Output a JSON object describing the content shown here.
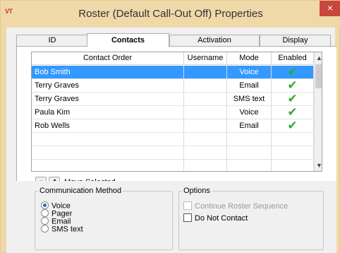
{
  "window": {
    "app_icon_text": "VT",
    "title": "Roster (Default Call-Out Off) Properties",
    "close_glyph": "×"
  },
  "tabs": [
    {
      "label": "ID",
      "active": false
    },
    {
      "label": "Contacts",
      "active": true
    },
    {
      "label": "Activation",
      "active": false
    },
    {
      "label": "Display",
      "active": false
    }
  ],
  "grid": {
    "columns": [
      "Contact Order",
      "Username",
      "Mode",
      "Enabled"
    ],
    "rows": [
      {
        "name": "Bob Smith",
        "username": "",
        "mode": "Voice",
        "enabled": true,
        "selected": true
      },
      {
        "name": "Terry Graves",
        "username": "",
        "mode": "Email",
        "enabled": true,
        "selected": false
      },
      {
        "name": "Terry Graves",
        "username": "",
        "mode": "SMS text",
        "enabled": true,
        "selected": false
      },
      {
        "name": "Paula Kim",
        "username": "",
        "mode": "Voice",
        "enabled": true,
        "selected": false
      },
      {
        "name": "Rob Wells",
        "username": "",
        "mode": "Email",
        "enabled": true,
        "selected": false
      },
      {
        "name": "",
        "username": "",
        "mode": "",
        "enabled": false,
        "selected": false
      },
      {
        "name": "",
        "username": "",
        "mode": "",
        "enabled": false,
        "selected": false
      },
      {
        "name": "",
        "username": "",
        "mode": "",
        "enabled": false,
        "selected": false
      }
    ],
    "check_glyph": "✔",
    "scroll_up_glyph": "▲",
    "scroll_down_glyph": "▼"
  },
  "move": {
    "label": "Move Selected",
    "up_icon": "arrow-up-icon",
    "down_icon": "arrow-down-icon"
  },
  "communication_method": {
    "legend": "Communication Method",
    "options": [
      {
        "label": "Voice",
        "checked": true
      },
      {
        "label": "Pager",
        "checked": false
      },
      {
        "label": "Email",
        "checked": false
      },
      {
        "label": "SMS text",
        "checked": false
      }
    ]
  },
  "options": {
    "legend": "Options",
    "continue_roster_sequence": {
      "label": "Continue Roster Sequence",
      "checked": false,
      "disabled": true
    },
    "do_not_contact": {
      "label": "Do Not Contact",
      "checked": false,
      "disabled": false
    }
  },
  "colors": {
    "title_bar": "#f0d9a8",
    "close_button": "#c7463d",
    "selection": "#3399ff",
    "check": "#34a82f"
  }
}
